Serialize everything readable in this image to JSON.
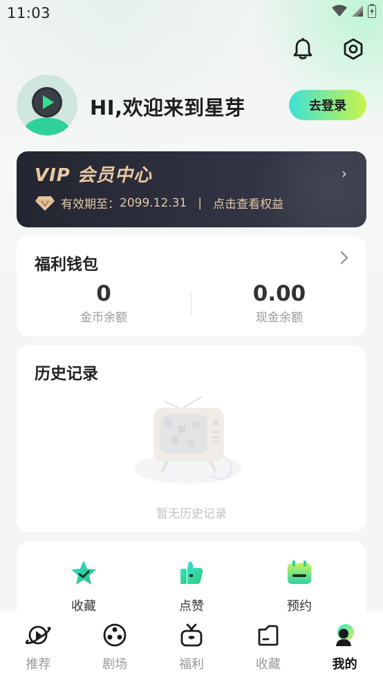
{
  "status_bar": {
    "time": "11:03"
  },
  "header": {
    "bell_icon": "bell-icon",
    "settings_icon": "settings-icon"
  },
  "profile": {
    "greeting": "HI,欢迎来到星芽",
    "login_label": "去登录",
    "login_gradient": [
      "#3ee0d6",
      "#c9f54a"
    ]
  },
  "vip": {
    "title": "VIP 会员中心",
    "expiry_label": "有效期至：",
    "expiry_date": "2099.12.31",
    "separator": "|",
    "benefits_link": "点击查看权益",
    "accent": "#e9c9a2"
  },
  "wallet": {
    "title": "福利钱包",
    "coins_value": "0",
    "coins_label": "金币余额",
    "cash_value": "0.00",
    "cash_label": "现金余额"
  },
  "history": {
    "title": "历史记录",
    "empty_text": "暂无历史记录"
  },
  "quick_actions": [
    {
      "label": "收藏",
      "icon": "star-check-icon"
    },
    {
      "label": "点赞",
      "icon": "thumb-up-icon"
    },
    {
      "label": "预约",
      "icon": "calendar-icon"
    }
  ],
  "bottom_nav": [
    {
      "label": "推荐",
      "icon": "planet-icon"
    },
    {
      "label": "剧场",
      "icon": "film-reel-icon"
    },
    {
      "label": "福利",
      "icon": "gift-icon"
    },
    {
      "label": "收藏",
      "icon": "folder-icon"
    },
    {
      "label": "我的",
      "icon": "profile-icon",
      "active": true
    }
  ]
}
